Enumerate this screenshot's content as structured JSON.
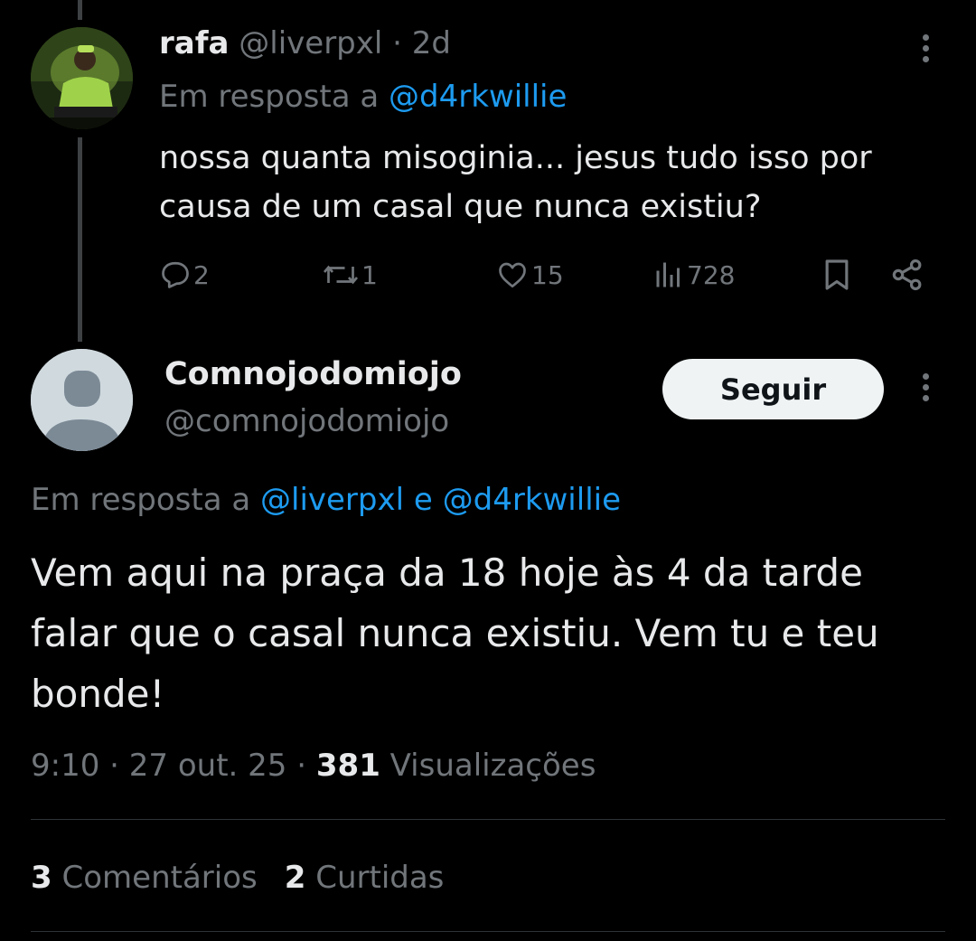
{
  "reply_tweet": {
    "author": {
      "display_name": "rafa",
      "handle": "@liverpxl",
      "time_ago": "2d",
      "avatar": "photo-avatar"
    },
    "in_reply_to_prefix": "Em resposta a",
    "in_reply_to": "@d4rkwillie",
    "text": "nossa quanta misoginia... jesus tudo isso por causa de um casal que nunca existiu?",
    "actions": {
      "replies": "2",
      "reposts": "1",
      "likes": "15",
      "views": "728"
    },
    "icons": [
      "reply-icon",
      "repost-icon",
      "like-icon",
      "views-icon",
      "bookmark-icon",
      "share-icon",
      "more-icon"
    ]
  },
  "main_tweet": {
    "author": {
      "display_name": "Comnojodomiojo",
      "handle": "@comnojodomiojo",
      "avatar": "default-avatar"
    },
    "follow_label": "Seguir",
    "in_reply_to_prefix": "Em resposta a",
    "in_reply_to_1": "@liverpxl",
    "in_reply_to_joiner": "e",
    "in_reply_to_2": "@d4rkwillie",
    "text": "Vem aqui na praça da 18 hoje às 4 da tarde falar que o casal nunca existiu. Vem tu e teu bonde!",
    "time": "9:10",
    "date": "27 out. 25",
    "views_count": "381",
    "views_label": "Visualizações",
    "comments_count": "3",
    "comments_label": "Comentários",
    "reposts_count": "2",
    "reposts_label": "Curtidas"
  },
  "colors": {
    "background": "#000000",
    "text": "#e7e9ea",
    "muted": "#71767b",
    "link": "#1d9bf0",
    "button_bg": "#eff3f4",
    "divider": "#2f3336"
  }
}
